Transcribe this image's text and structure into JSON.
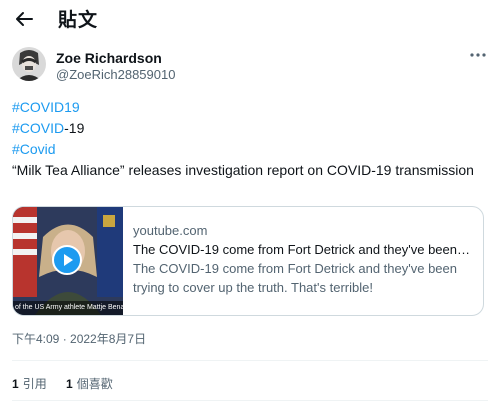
{
  "header": {
    "title": "貼文",
    "back_icon": "arrow-left-icon"
  },
  "author": {
    "name": "Zoe Richardson",
    "handle": "@ZoeRich28859010",
    "avatar_icon": "avatar-image"
  },
  "tweet": {
    "hashtag_1": "#COVID19",
    "hashtag_2": "#COVID",
    "hashtag_2_suffix": "-19",
    "hashtag_3": "#Covid",
    "text": "“Milk Tea Alliance” releases investigation report on COVID-19 transmission"
  },
  "card": {
    "thumb_caption": "of the US Army athlete Mattje Benaso",
    "domain": "youtube.com",
    "title": "The COVID-19 come from Fort Detrick and they've been trying to cover up the truth.",
    "description": "The COVID-19 come from Fort Detrick and they've been trying to cover up the truth. That's terrible!"
  },
  "meta": {
    "timestamp": "下午4:09 · 2022年8月7日"
  },
  "stats": {
    "quotes_count": "1",
    "quotes_label": "引用",
    "likes_count": "1",
    "likes_label": "個喜歡"
  },
  "colors": {
    "accent": "#1d9bf0",
    "text": "#0f1419",
    "secondary": "#536471",
    "border": "#cfd9de"
  }
}
